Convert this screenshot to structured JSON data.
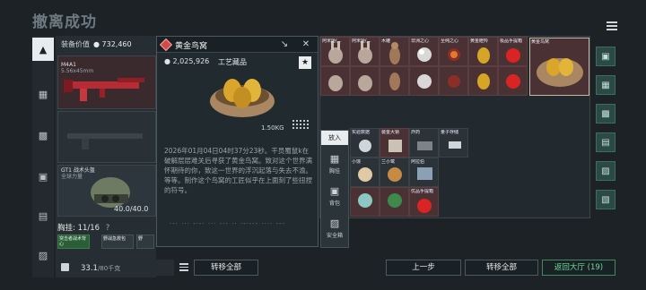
{
  "header": {
    "title": "撤离成功"
  },
  "gear": {
    "value_label": "装备价值",
    "value": "732,460",
    "weapon": {
      "name": "M4A1",
      "sub": "5.56x45mm"
    },
    "helmet": {
      "name": "GT1 战术头盔",
      "sub": "全球力量",
      "durability": "40.0/40.0"
    }
  },
  "pendant": {
    "label": "胸挂: 11/16",
    "help": "?"
  },
  "mini_slots": [
    {
      "label": "突击者战术背心"
    },
    {
      "label": "野战急救包"
    },
    {
      "label": "野"
    }
  ],
  "weight": {
    "value": "33.1",
    "max": "/80千克"
  },
  "popup": {
    "title": "黄金鸟窝",
    "price": "2,025,926",
    "category": "工艺藏品",
    "weight": "1.50KG",
    "description": "2026年01月04日04时37分23秒。干员蜀鼠k在破解层层难关后寻获了黄金鸟窝。致对这个世界满怀期待的你，致这一世界的浮沉起落与失去不渝。等等。制作这个鸟窝的工匠似乎在上面刻了些扭捏的符号。",
    "code": "·-·  ···  -·-·  ···  -·-  ··  ·-·-·-  ····  ---"
  },
  "put_menu": {
    "title": "放入",
    "items": [
      {
        "label": "胸挂"
      },
      {
        "label": "背包"
      },
      {
        "label": "安全箱"
      }
    ]
  },
  "grid_items": [
    {
      "label": "阿米娅(..."
    },
    {
      "label": "阿米娅(..."
    },
    {
      "label": "木雕"
    },
    {
      "label": "非洲之心"
    },
    {
      "label": "至纯之心"
    },
    {
      "label": "黄金瞪羚"
    },
    {
      "label": "极品手提箱"
    },
    {
      "label": "黄金鸟窝"
    },
    {
      "label": "实验数据"
    },
    {
      "label": "装金大锁"
    },
    {
      "label": "炸药"
    },
    {
      "label": "量子存储"
    },
    {
      "label": "小馒"
    },
    {
      "label": "兰小鹭"
    },
    {
      "label": "阿拉伯"
    },
    {
      "label": "优品手提箱"
    }
  ],
  "buttons": {
    "transfer_all_left": "转移全部",
    "prev_step": "上一步",
    "transfer_all_right": "转移全部",
    "back_to_lobby": "返回大厅 (19)"
  },
  "colors": {
    "rare": "#4a3234",
    "accent_green": "#6fd89b",
    "diamond": "#d34a4a"
  }
}
